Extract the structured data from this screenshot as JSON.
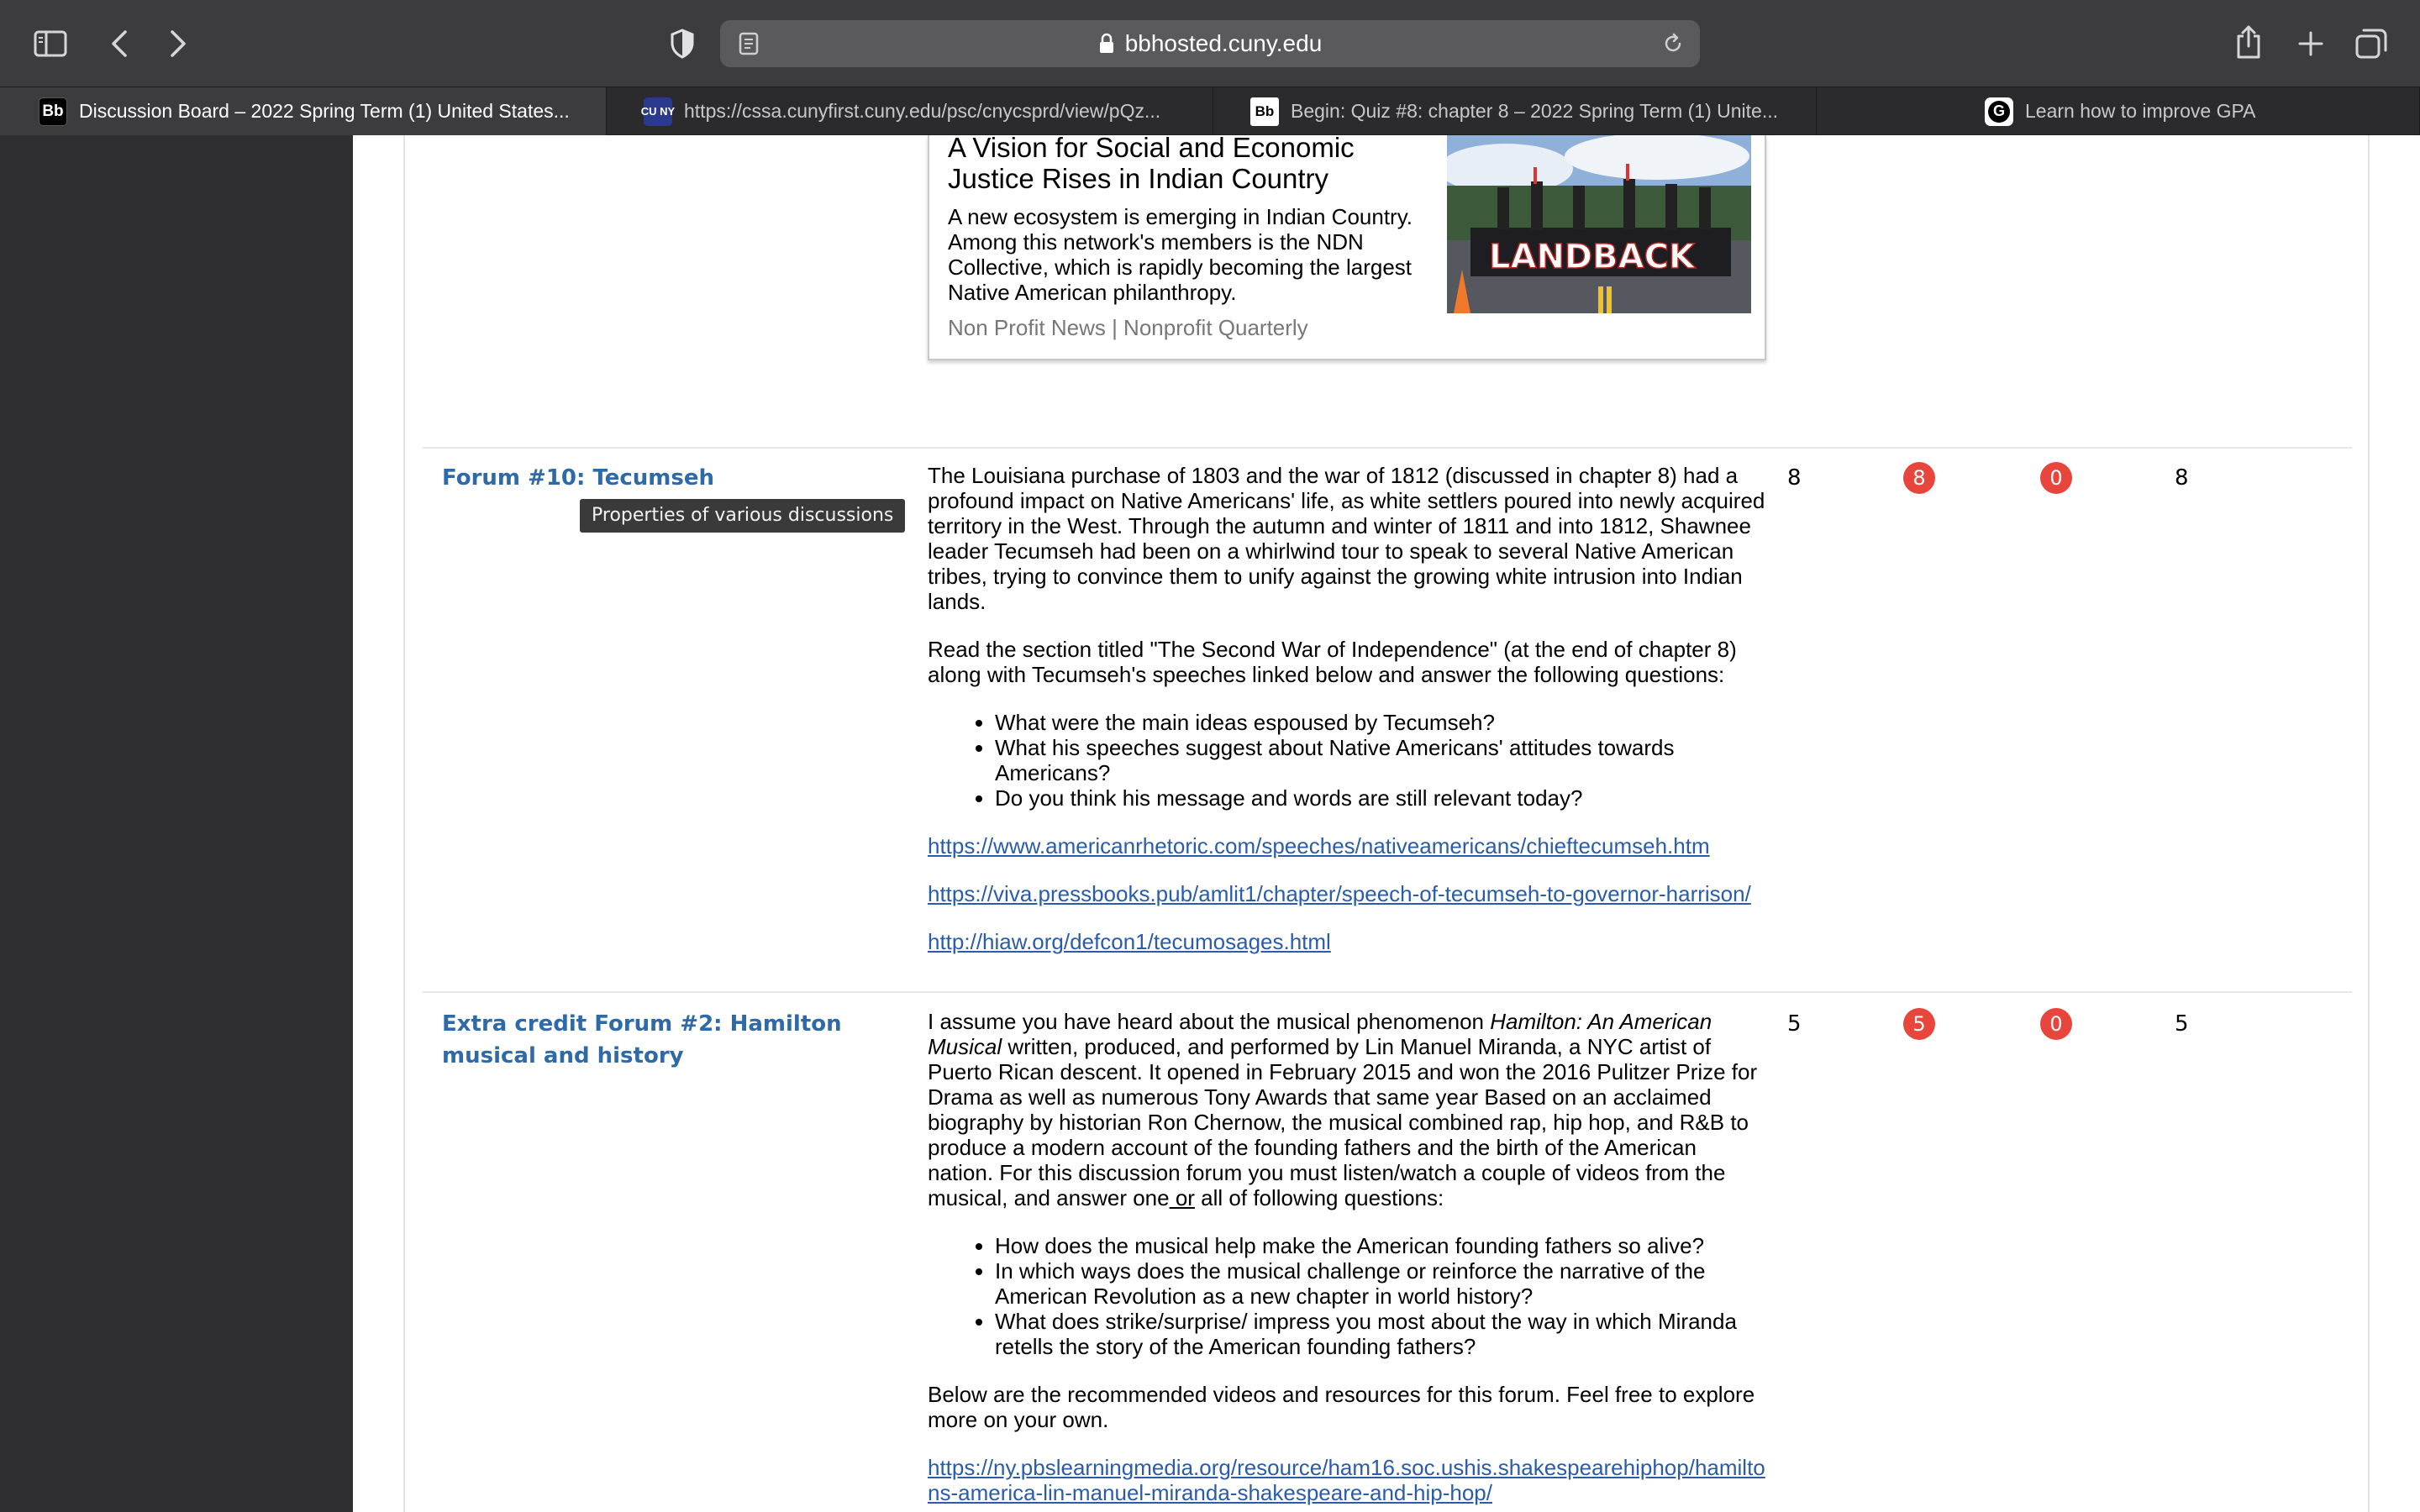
{
  "browser": {
    "address": "bbhosted.cuny.edu",
    "tabs": [
      {
        "favicon": "Bb",
        "title": "Discussion Board – 2022 Spring Term (1) United States..."
      },
      {
        "favicon": "CU NY",
        "title": "https://cssa.cunyfirst.cuny.edu/psc/cnycsprd/view/pQz..."
      },
      {
        "favicon": "Bb",
        "title": "Begin: Quiz #8: chapter 8 – 2022 Spring Term (1) Unite..."
      },
      {
        "favicon": "G",
        "title": "Learn how to improve GPA"
      }
    ]
  },
  "preview": {
    "title": "A Vision for Social and Economic Justice Rises in Indian Country",
    "description": "A new ecosystem is emerging in Indian Country. Among this network's members is the NDN Collective, which is rapidly becoming the largest Native American philanthropy.",
    "source": "Non Profit News | Nonprofit Quarterly",
    "image_text": "LANDBACK"
  },
  "tooltip": "Properties of various discussions",
  "forums": [
    {
      "title": "Forum #10: Tecumseh",
      "total_posts": "8",
      "unread_posts": "8",
      "replies_to_me": "0",
      "participants": "8",
      "paragraphs": [
        "The Louisiana purchase of 1803 and the war of 1812 (discussed in chapter 8) had a profound impact on Native Americans' life, as white settlers poured into newly acquired territory in the West. Through the autumn and winter of 1811 and into 1812, Shawnee leader Tecumseh had been on a whirlwind tour to speak to several Native American tribes, trying to convince them to unify against the growing white intrusion into Indian lands.",
        "Read the section titled \"The Second War of Independence\" (at the end of chapter 8) along with Tecumseh's speeches linked below and answer the following questions:"
      ],
      "questions": [
        "What were the main ideas espoused by Tecumseh?",
        "What his speeches suggest about Native Americans' attitudes towards Americans?",
        "Do you think his message and words are still relevant today?"
      ],
      "links": [
        "https://www.americanrhetoric.com/speeches/nativeamericans/chieftecumseh.htm",
        "https://viva.pressbooks.pub/amlit1/chapter/speech-of-tecumseh-to-governor-harrison/",
        "http://hiaw.org/defcon1/tecumosages.html"
      ]
    },
    {
      "title": "Extra credit Forum #2: Hamilton musical and history",
      "total_posts": "5",
      "unread_posts": "5",
      "replies_to_me": "0",
      "participants": "5",
      "intro_pre": "I assume you have heard about the musical phenomenon ",
      "intro_italic": "Hamilton: An American Musical",
      "intro_post": " written, produced, and performed by Lin Manuel Miranda, a NYC artist of Puerto Rican descent. It opened in February 2015 and won the 2016 Pulitzer Prize for Drama as well as numerous Tony Awards that same year  Based on an acclaimed biography by historian Ron Chernow, the musical combined rap, hip hop, and R&B to produce a modern account of the founding fathers  and the birth of the American nation. For this discussion forum you must listen/watch a couple of videos from the musical, and answer one",
      "intro_underlined": " or",
      "intro_end": " all of following questions:",
      "questions": [
        "How does the musical help make the American founding fathers so alive?",
        "In which ways does the musical challenge or reinforce the narrative of the American Revolution as a new chapter in world history?",
        "What does strike/surprise/ impress you most about the way in which Miranda retells the story of the American founding fathers?"
      ],
      "closing": "Below are the recommended videos and resources for this forum. Feel free to explore more on your own.",
      "links": [
        "https://ny.pbslearningmedia.org/resource/ham16.soc.ushis.shakespearehiphop/hamiltons-america-lin-manuel-miranda-shakespeare-and-hip-hop/"
      ]
    }
  ],
  "colors": {
    "link": "#2a5caa",
    "forum_title": "#2f6aa8",
    "badge": "#e8453c",
    "chrome": "#3c3b3e"
  }
}
